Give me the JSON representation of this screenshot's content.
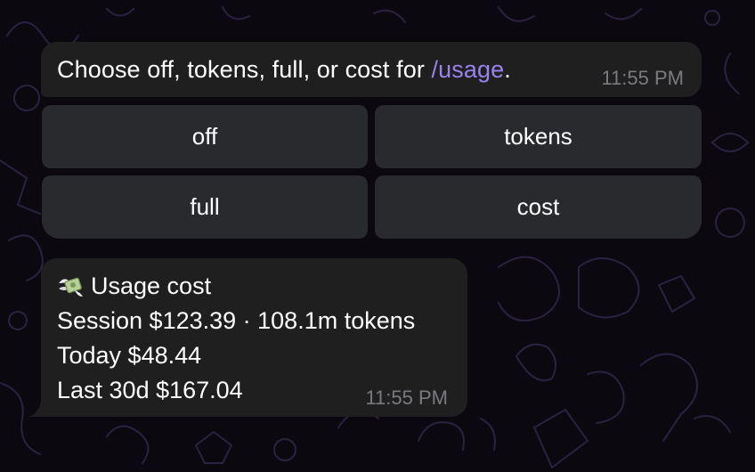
{
  "messages": [
    {
      "text_before": "Choose off, tokens, full, or cost for ",
      "command": "/usage",
      "text_after": ".",
      "time": "11:55 PM"
    },
    {
      "icon": "money-wings-icon",
      "lines": [
        "Usage cost",
        "Session $123.39 · 108.1m tokens",
        "Today $48.44",
        "Last 30d $167.04"
      ],
      "time": "11:55 PM"
    }
  ],
  "keyboard": {
    "buttons": [
      "off",
      "tokens",
      "full",
      "cost"
    ]
  },
  "colors": {
    "background": "#0b090f",
    "bubble": "#1f1f20",
    "button": "#303234",
    "link": "#9a83ec",
    "timestamp": "#7a7a80",
    "doodle": "#3a2a55"
  }
}
